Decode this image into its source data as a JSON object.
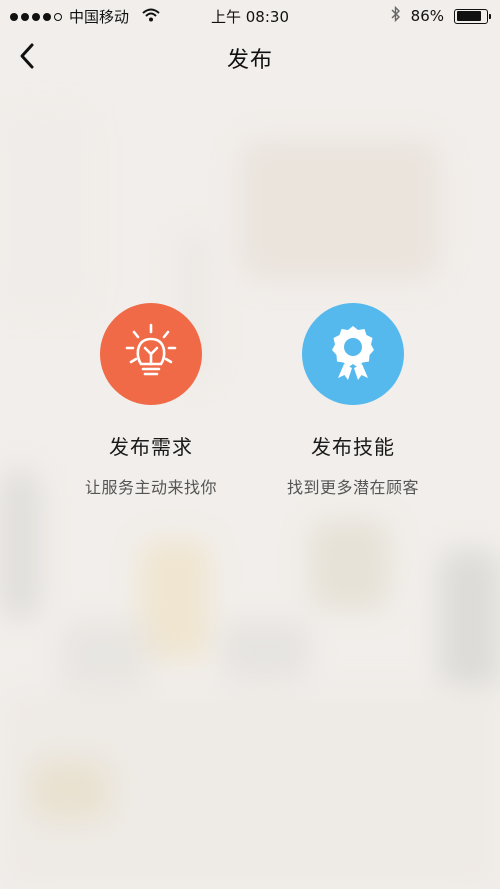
{
  "status_bar": {
    "carrier": "中国移动",
    "time": "上午 08:30",
    "battery": "86%",
    "battery_level": 0.86,
    "signal_bars": 4,
    "signal_max": 5
  },
  "nav": {
    "title": "发布",
    "back_icon": "chevron-left-icon"
  },
  "options": [
    {
      "title": "发布需求",
      "subtitle": "让服务主动来找你",
      "icon": "lightbulb-icon",
      "color": "#f06a47"
    },
    {
      "title": "发布技能",
      "subtitle": "找到更多潜在顾客",
      "icon": "award-badge-icon",
      "color": "#56b9ee"
    }
  ]
}
